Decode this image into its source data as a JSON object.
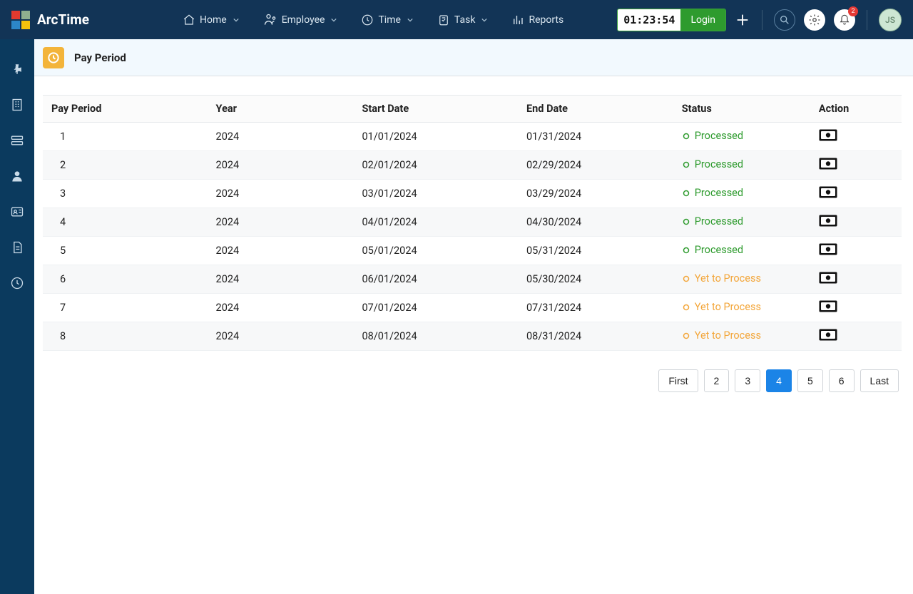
{
  "brand": "ArcTime",
  "nav": {
    "home": "Home",
    "employee": "Employee",
    "time": "Time",
    "task": "Task",
    "reports": "Reports"
  },
  "timer_value": "01:23:54",
  "login_label": "Login",
  "notification_count": "2",
  "avatar_initials": "JS",
  "page_title": "Pay Period",
  "table": {
    "headers": {
      "pay_period": "Pay Period",
      "year": "Year",
      "start": "Start Date",
      "end": "End Date",
      "status": "Status",
      "action": "Action"
    },
    "status_labels": {
      "processed": "Processed",
      "pending": "Yet to Process"
    },
    "rows": [
      {
        "period": "1",
        "year": "2024",
        "start": "01/01/2024",
        "end": "01/31/2024",
        "status": "processed"
      },
      {
        "period": "2",
        "year": "2024",
        "start": "02/01/2024",
        "end": "02/29/2024",
        "status": "processed"
      },
      {
        "period": "3",
        "year": "2024",
        "start": "03/01/2024",
        "end": "03/29/2024",
        "status": "processed"
      },
      {
        "period": "4",
        "year": "2024",
        "start": "04/01/2024",
        "end": "04/30/2024",
        "status": "processed"
      },
      {
        "period": "5",
        "year": "2024",
        "start": "05/01/2024",
        "end": "05/31/2024",
        "status": "processed"
      },
      {
        "period": "6",
        "year": "2024",
        "start": "06/01/2024",
        "end": "05/30/2024",
        "status": "pending"
      },
      {
        "period": "7",
        "year": "2024",
        "start": "07/01/2024",
        "end": "07/31/2024",
        "status": "pending"
      },
      {
        "period": "8",
        "year": "2024",
        "start": "08/01/2024",
        "end": "08/31/2024",
        "status": "pending"
      }
    ]
  },
  "pagination": {
    "first": "First",
    "last": "Last",
    "pages": [
      "2",
      "3",
      "4",
      "5",
      "6"
    ],
    "active": "4"
  }
}
